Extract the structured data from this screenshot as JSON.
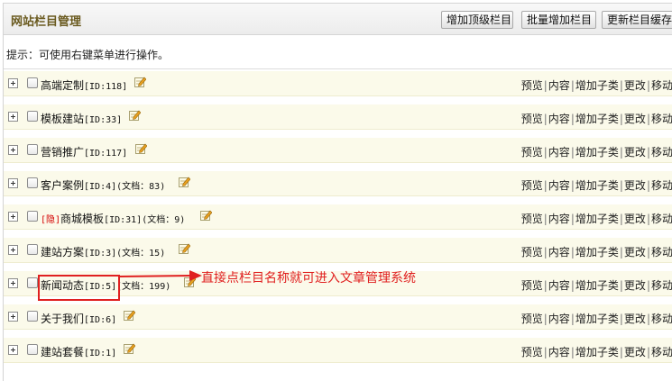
{
  "header": {
    "title": "网站栏目管理",
    "buttons": {
      "add_top": "增加顶级栏目",
      "batch_add": "批量增加栏目",
      "update_cache": "更新栏目缓存"
    }
  },
  "tip": "提示：可使用右键菜单进行操作。",
  "actions": {
    "preview": "预览",
    "content": "内容",
    "add_sub": "增加子类",
    "edit": "更改",
    "move": "移动"
  },
  "rows": [
    {
      "label": "高端定制",
      "id": "[ID:118]",
      "docs": ""
    },
    {
      "label": "模板建站",
      "id": "[ID:33]",
      "docs": ""
    },
    {
      "label": "营销推广",
      "id": "[ID:117]",
      "docs": ""
    },
    {
      "label": "客户案例",
      "id": "[ID:4]",
      "docs": "(文档：83)"
    },
    {
      "hidden_tag": "[隐]",
      "label": "商城模板",
      "id": "[ID:31]",
      "docs": "(文档：9)"
    },
    {
      "label": "建站方案",
      "id": "[ID:3]",
      "docs": "(文档：15)"
    },
    {
      "label": "新闻动态",
      "id": "[ID:5]",
      "docs": "(文档：199)"
    },
    {
      "label": "关于我们",
      "id": "[ID:6]",
      "docs": ""
    },
    {
      "label": "建站套餐",
      "id": "[ID:1]",
      "docs": ""
    }
  ],
  "annotation": "直接点栏目名称就可进入文章管理系统",
  "colors": {
    "row_bg": "#fbfaea",
    "annotation": "#e02020",
    "title": "#6a5a1f"
  }
}
